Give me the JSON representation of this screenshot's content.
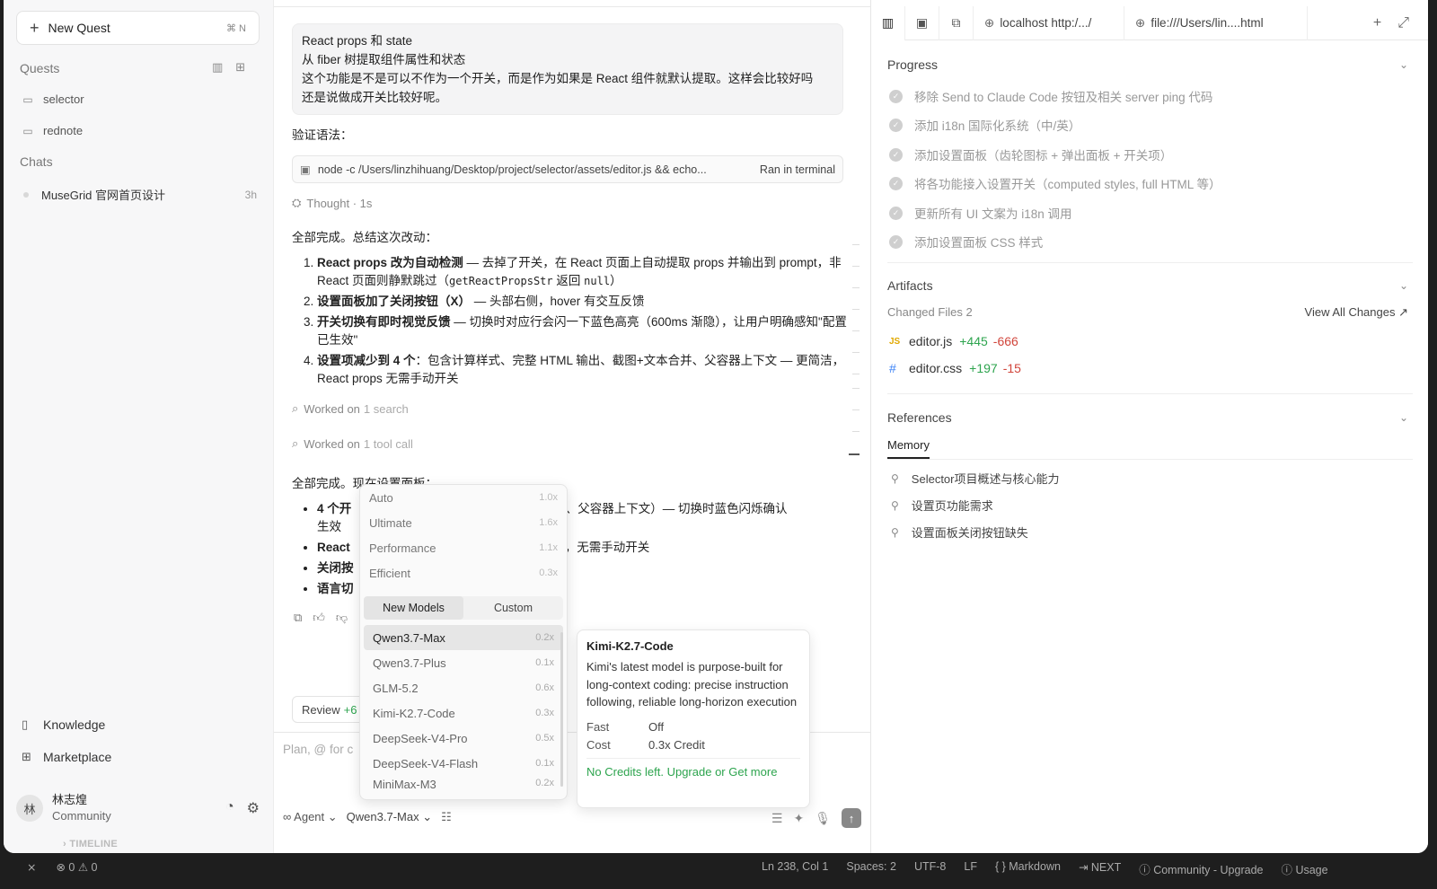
{
  "sidebar": {
    "new_quest": "New Quest",
    "new_quest_shortcut": "⌘ N",
    "quests_label": "Quests",
    "quests": [
      {
        "label": "selector"
      },
      {
        "label": "rednote"
      }
    ],
    "chats_label": "Chats",
    "chats": [
      {
        "label": "MuseGrid 官网首页设计",
        "time": "3h"
      }
    ],
    "bottom": [
      {
        "label": "Knowledge"
      },
      {
        "label": "Marketplace"
      }
    ],
    "user": {
      "avatar": "林",
      "name": "林志煌",
      "plan": "Community"
    }
  },
  "chat": {
    "user_message": [
      "React props 和 state",
      "从 fiber 树提取组件属性和状态",
      "这个功能是不是可以不作为一个开关，而是作为如果是 React 组件就默认提取。这样会比较好吗",
      "还是说做成开关比较好呢。"
    ],
    "verify_label": "验证语法：",
    "command": "node -c /Users/linzhihuang/Desktop/project/selector/assets/editor.js && echo...",
    "command_status": "Ran in terminal",
    "thought": "Thought · 1s",
    "summary_title": "全部完成。总结这次改动：",
    "summary": [
      {
        "bold": "React props 改为自动检测",
        "text1": " — 去掉了开关，在 React 页面上自动提取 props 并输出到 prompt，非 React 页面则静默跳过（",
        "code": "getReactPropsStr",
        "text2": " 返回 ",
        "code2": "null",
        "text3": "）"
      },
      {
        "bold": "设置面板加了关闭按钮（X）",
        "text1": " — 头部右侧，hover 有交互反馈"
      },
      {
        "bold": "开关切换有即时视觉反馈",
        "text1": " — 切换时对应行会闪一下蓝色高亮（600ms 渐隐），让用户明确感知\"配置已生效\""
      },
      {
        "bold": "设置项减少到 4 个",
        "text1": "：包含计算样式、完整 HTML 输出、截图+文本合并、父容器上下文 — 更简洁，React props 无需手动开关"
      }
    ],
    "worked1": {
      "label": "Worked on",
      "detail": "1 search"
    },
    "worked2": {
      "label": "Worked on",
      "detail": "1 tool call"
    },
    "summary2_title": "全部完成。现在设置面板：",
    "summary2": [
      {
        "bold": "4 个开",
        "text": "本合并、父容器上下文）— 切换时蓝色闪烁确认",
        "text_cont": "生效"
      },
      {
        "bold": "React",
        "text": "跳过，无需手动开关"
      },
      {
        "bold": "关闭按",
        "text": ""
      },
      {
        "bold": "语言切",
        "text": ""
      }
    ],
    "review_label": "Review",
    "review_count": "+6",
    "composer_placeholder": "Plan, @ for c",
    "agent_label": "Agent",
    "model_label": "Qwen3.7-Max"
  },
  "dropdown": {
    "presets": [
      {
        "name": "Auto",
        "mult": "1.0x"
      },
      {
        "name": "Ultimate",
        "mult": "1.6x"
      },
      {
        "name": "Performance",
        "mult": "1.1x"
      },
      {
        "name": "Efficient",
        "mult": "0.3x"
      }
    ],
    "tabs": [
      "New Models",
      "Custom"
    ],
    "models": [
      {
        "name": "Qwen3.7-Max",
        "mult": "0.2x"
      },
      {
        "name": "Qwen3.7-Plus",
        "mult": "0.1x"
      },
      {
        "name": "GLM-5.2",
        "mult": "0.6x"
      },
      {
        "name": "Kimi-K2.7-Code",
        "mult": "0.3x"
      },
      {
        "name": "DeepSeek-V4-Pro",
        "mult": "0.5x"
      },
      {
        "name": "DeepSeek-V4-Flash",
        "mult": "0.1x"
      },
      {
        "name": "MiniMax-M3",
        "mult": "0.2x"
      }
    ]
  },
  "tooltip": {
    "title": "Kimi-K2.7-Code",
    "desc": "Kimi's latest model is purpose-built for long-context coding: precise instruction following, reliable long-horizon execution",
    "fast_k": "Fast",
    "fast_v": "Off",
    "cost_k": "Cost",
    "cost_v": "0.3x Credit",
    "link": "No Credits left. Upgrade or Get more"
  },
  "right": {
    "tabs": [
      {
        "label": "localhost  http:/.../"
      },
      {
        "label": "file:///Users/lin....html"
      }
    ],
    "progress_label": "Progress",
    "progress": [
      "移除 Send to Claude Code 按钮及相关 server ping 代码",
      "添加 i18n 国际化系统（中/英）",
      "添加设置面板（齿轮图标 + 弹出面板 + 开关项）",
      "将各功能接入设置开关（computed styles, full HTML 等）",
      "更新所有 UI 文案为 i18n 调用",
      "添加设置面板 CSS 样式"
    ],
    "artifacts_label": "Artifacts",
    "changed_files": "Changed Files  2",
    "view_all": "View All Changes ↗",
    "files": [
      {
        "type": "JS",
        "name": "editor.js",
        "add": "+445",
        "del": "-666"
      },
      {
        "type": "#",
        "name": "editor.css",
        "add": "+197",
        "del": "-15"
      }
    ],
    "references_label": "References",
    "memory_tab": "Memory",
    "memories": [
      "Selector项目概述与核心能力",
      "设置页功能需求",
      "设置面板关闭按钮缺失"
    ]
  },
  "status": {
    "timeline": "TIMELINE",
    "errors": "⊗ 0 ⚠ 0",
    "cursor": "Ln 238, Col 1",
    "spaces": "Spaces: 2",
    "encoding": "UTF-8",
    "eol": "LF",
    "lang": "{ } Markdown",
    "next": "⇥ NEXT",
    "community": "ⓘ Community - Upgrade",
    "usage": "ⓘ Usage"
  }
}
